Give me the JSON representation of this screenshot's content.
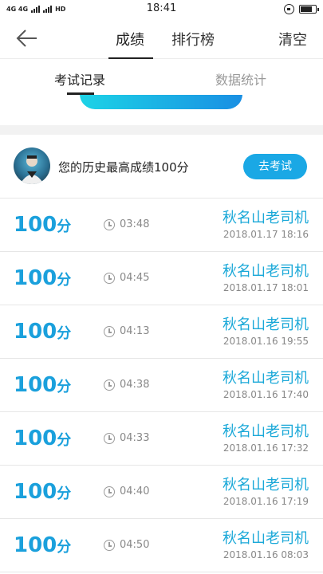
{
  "status": {
    "left_text": "4G 4G",
    "hd": "HD",
    "time": "18:41"
  },
  "nav": {
    "tab_scores": "成绩",
    "tab_ranking": "排行榜",
    "clear": "清空"
  },
  "subtabs": {
    "exam_records": "考试记录",
    "data_stats": "数据统计"
  },
  "best": {
    "text": "您的历史最高成绩100分",
    "button": "去考试"
  },
  "records": [
    {
      "score": "100",
      "unit": "分",
      "duration": "03:48",
      "name": "秋名山老司机",
      "date": "2018.01.17  18:16"
    },
    {
      "score": "100",
      "unit": "分",
      "duration": "04:45",
      "name": "秋名山老司机",
      "date": "2018.01.17  18:01"
    },
    {
      "score": "100",
      "unit": "分",
      "duration": "04:13",
      "name": "秋名山老司机",
      "date": "2018.01.16  19:55"
    },
    {
      "score": "100",
      "unit": "分",
      "duration": "04:38",
      "name": "秋名山老司机",
      "date": "2018.01.16  17:40"
    },
    {
      "score": "100",
      "unit": "分",
      "duration": "04:33",
      "name": "秋名山老司机",
      "date": "2018.01.16  17:32"
    },
    {
      "score": "100",
      "unit": "分",
      "duration": "04:40",
      "name": "秋名山老司机",
      "date": "2018.01.16  17:19"
    },
    {
      "score": "100",
      "unit": "分",
      "duration": "04:50",
      "name": "秋名山老司机",
      "date": "2018.01.16  08:03"
    }
  ],
  "colors": {
    "accent": "#1aa8e5",
    "score": "#1aa0dc"
  }
}
